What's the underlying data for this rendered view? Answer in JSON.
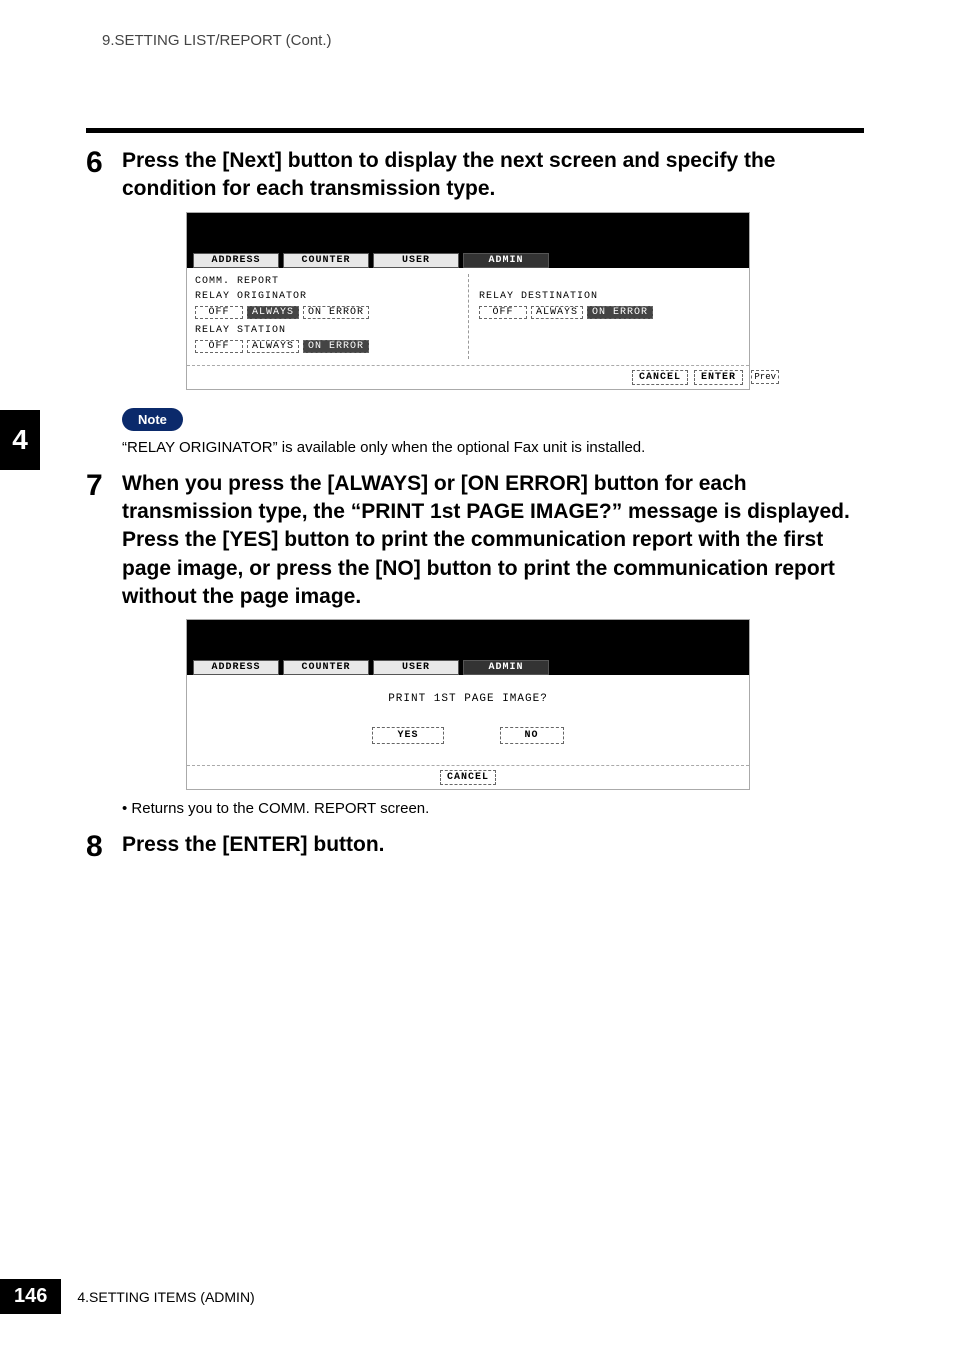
{
  "header": {
    "breadcrumb": "9.SETTING LIST/REPORT (Cont.)"
  },
  "sideTab": "4",
  "step6": {
    "num": "6",
    "text": "Press the [Next] button to display the next screen and specify the condition for each transmission type."
  },
  "screen1": {
    "tabs": [
      "ADDRESS",
      "COUNTER",
      "USER",
      "ADMIN"
    ],
    "activeTabIndex": 3,
    "title": "COMM. REPORT",
    "left": {
      "group1": {
        "label": "RELAY ORIGINATOR",
        "buttons": [
          "OFF",
          "ALWAYS",
          "ON ERROR"
        ],
        "selectedIndex": 1
      },
      "group2": {
        "label": "RELAY STATION",
        "buttons": [
          "OFF",
          "ALWAYS",
          "ON ERROR"
        ],
        "selectedIndex": 2
      }
    },
    "right": {
      "group1": {
        "label": "RELAY DESTINATION",
        "buttons": [
          "OFF",
          "ALWAYS",
          "ON ERROR"
        ],
        "selectedIndex": 2
      }
    },
    "footer": {
      "cancel": "CANCEL",
      "enter": "ENTER",
      "prev": "Prev"
    }
  },
  "note": {
    "label": "Note",
    "text": "“RELAY ORIGINATOR” is available only when the optional Fax unit is installed."
  },
  "step7": {
    "num": "7",
    "text": "When you press the [ALWAYS] or [ON ERROR] button for each transmission type, the “PRINT 1st PAGE IMAGE?” message is displayed. Press the [YES] button to print the communication report with the first page image, or press the [NO] button to print the communication report without the page image."
  },
  "screen2": {
    "tabs": [
      "ADDRESS",
      "COUNTER",
      "USER",
      "ADMIN"
    ],
    "activeTabIndex": 3,
    "message": "PRINT 1ST PAGE IMAGE?",
    "yes": "YES",
    "no": "NO",
    "cancel": "CANCEL"
  },
  "bullet": "Returns you to the COMM. REPORT screen.",
  "step8": {
    "num": "8",
    "text": "Press the [ENTER] button."
  },
  "pageFooter": {
    "num": "146",
    "caption": "4.SETTING ITEMS (ADMIN)"
  }
}
